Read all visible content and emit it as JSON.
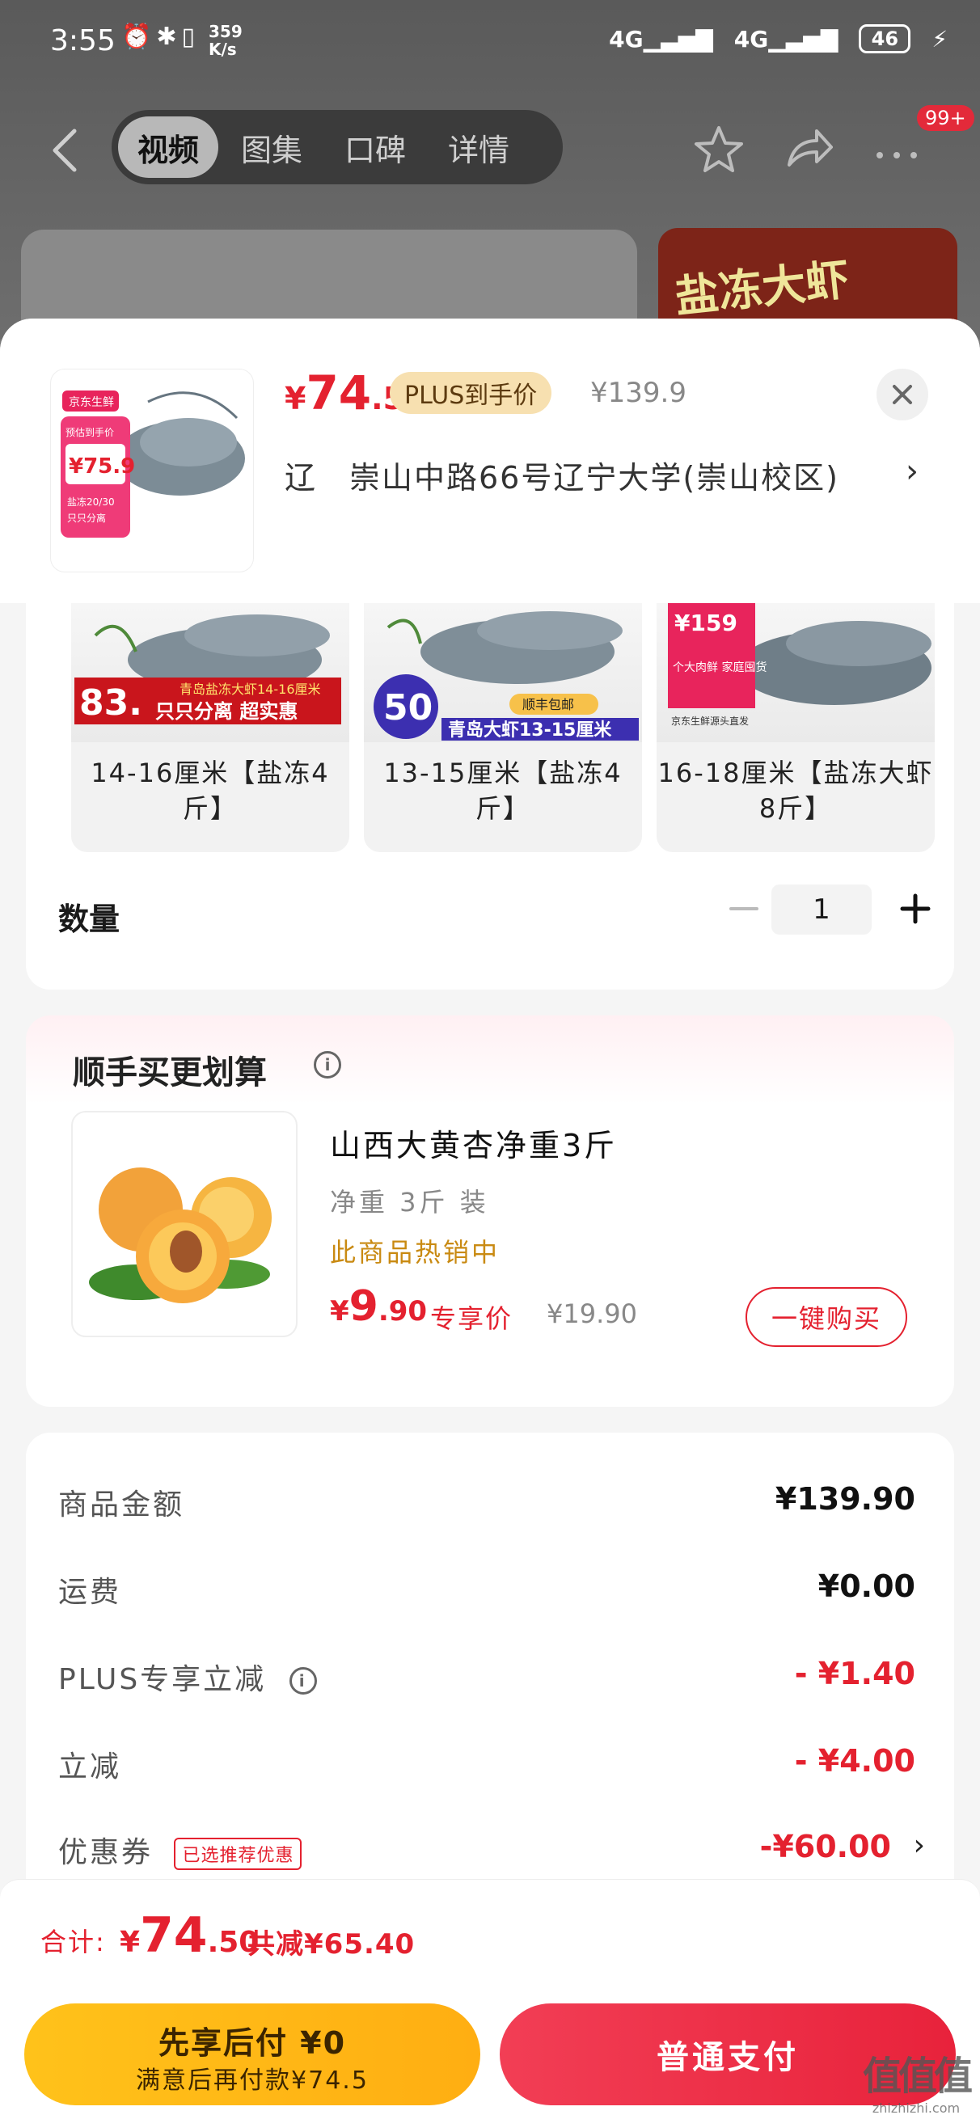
{
  "status_bar": {
    "time": "3:55",
    "speed_value": "359",
    "speed_unit": "K/s",
    "network_1": "4G",
    "network_2": "4G",
    "battery": "46"
  },
  "nav": {
    "tabs": [
      {
        "label": "视频",
        "active": true
      },
      {
        "label": "图集",
        "active": false
      },
      {
        "label": "口碑",
        "active": false
      },
      {
        "label": "详情",
        "active": false
      }
    ],
    "badge": "99+"
  },
  "background": {
    "promo_text": "盐冻大虾"
  },
  "product": {
    "price_currency": "¥",
    "price_int": "74",
    "price_dec": ".5",
    "plus_tag": "PLUS到手价",
    "original_price": "¥139.9",
    "address": "辽　崇山中路66号辽宁大学(崇山校区)",
    "thumb_brand": "京东生鲜",
    "thumb_price_label": "预估到手价",
    "thumb_price": "¥75.9",
    "thumb_spec_1": "盐冻20/30",
    "thumb_spec_2": "只只分离"
  },
  "specs": {
    "items": [
      {
        "label": "14-16厘米【盐冻4斤】",
        "img_text": "青岛盐冻大虾14-16厘米",
        "img_badge": "83.",
        "img_slogan": "只只分离 超实惠"
      },
      {
        "label": "13-15厘米【盐冻4斤】",
        "img_text": "青岛大虾13-15厘米",
        "img_badge": "50",
        "img_slogan": "顺丰包邮"
      },
      {
        "label": "16-18厘米【盐冻大虾8斤】",
        "img_text": "个大肉鲜 家庭囤货",
        "img_badge": "¥159",
        "img_slogan": "京东生鲜源头直发"
      }
    ],
    "qty_label": "数量",
    "qty_value": "1"
  },
  "upsell": {
    "title": "顺手买更划算",
    "name": "山西大黄杏净重3斤",
    "spec": "净重 3斤 装",
    "hot": "此商品热销中",
    "price_currency": "¥",
    "price_int": "9",
    "price_dec": ".90",
    "exclusive": "专享价",
    "original_price": "¥19.90",
    "buy_button": "一键购买"
  },
  "summary": {
    "rows": [
      {
        "label": "商品金额",
        "value": "¥139.90",
        "red": false
      },
      {
        "label": "运费",
        "value": "¥0.00",
        "red": false
      },
      {
        "label": "PLUS专享立减",
        "value": "- ¥1.40",
        "red": true,
        "info": true
      },
      {
        "label": "立减",
        "value": "- ¥4.00",
        "red": true
      },
      {
        "label": "优惠券",
        "value": "-¥60.00",
        "red": true,
        "tag": "已选推荐优惠",
        "chevron": true
      }
    ]
  },
  "total": {
    "label": "合计:",
    "price_currency": "¥",
    "price_int": "74",
    "price_dec": ".50",
    "saved": "共减¥65.40"
  },
  "actions": {
    "later_main": "先享后付 ¥0",
    "later_sub": "满意后再付款¥74.5",
    "pay": "普通支付"
  },
  "watermark": {
    "logo": "值值值",
    "url": "zhizhizhi.com"
  },
  "colors": {
    "accent_red": "#e4212f",
    "plus_gold": "#f7e0b0",
    "later_yellow": "#ffb816",
    "hot_orange": "#c98a12"
  }
}
